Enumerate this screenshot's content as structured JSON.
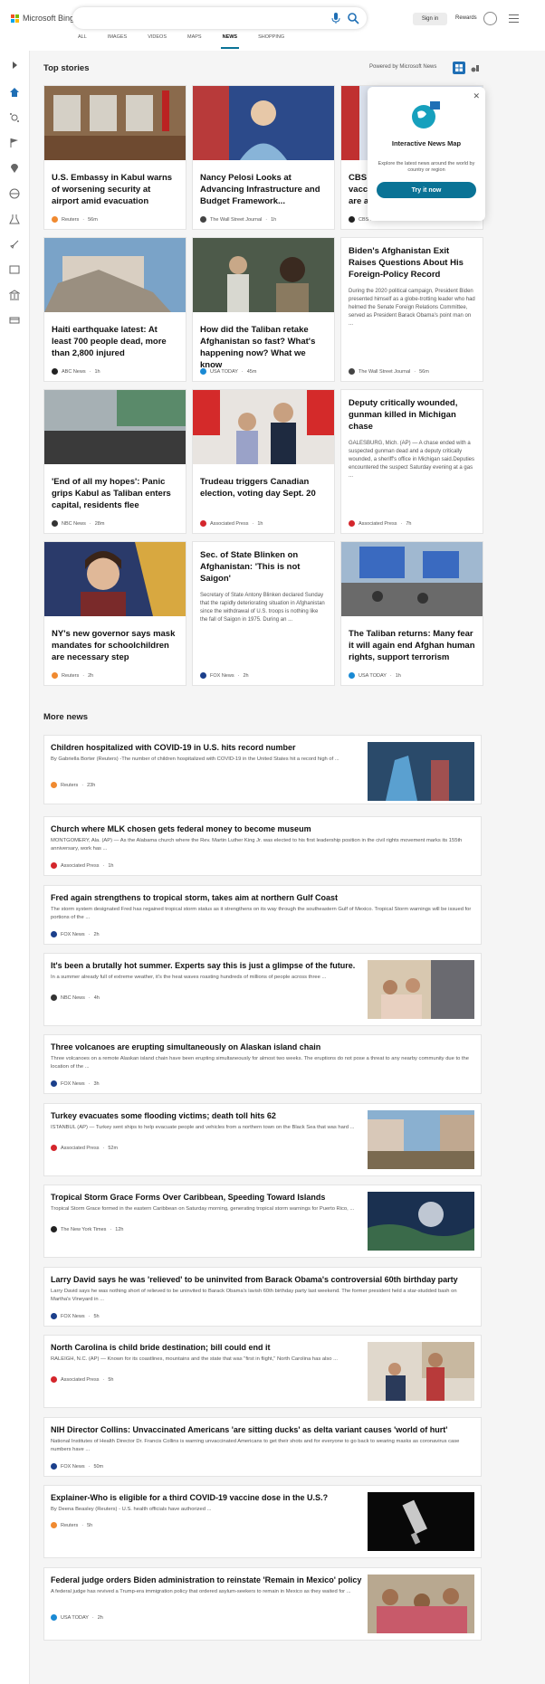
{
  "header": {
    "logo_text": "Microsoft Bing",
    "search_value": "",
    "signin": "Sign in",
    "rewards": "Rewards",
    "tabs": [
      "ALL",
      "IMAGES",
      "VIDEOS",
      "MAPS",
      "NEWS",
      "SHOPPING"
    ],
    "active_tab": "NEWS"
  },
  "top_stories": {
    "title": "Top stories",
    "powered_by": "Powered by Microsoft News",
    "cards": [
      {
        "title": "U.S. Embassy in Kabul warns of worsening security at airport amid evacuation",
        "source": "Reuters",
        "time": "56m",
        "src_color": "#f08a30"
      },
      {
        "title": "Nancy Pelosi Looks at Advancing Infrastructure and Budget Framework...",
        "source": "The Wall Street Journal",
        "time": "1h",
        "src_color": "#444444"
      },
      {
        "title": "CBS vacc are a",
        "source": "CBS News",
        "time": "2h",
        "src_color": "#222222"
      },
      {
        "title": "Haiti earthquake latest: At least 700 people dead, more than 2,800 injured",
        "source": "ABC News",
        "time": "1h",
        "src_color": "#222222"
      },
      {
        "title": "How did the Taliban retake Afghanistan so fast? What's happening now? What we know",
        "source": "USA TODAY",
        "time": "45m",
        "src_color": "#1a8ad4"
      },
      {
        "title": "Biden's Afghanistan Exit Raises Questions About His Foreign-Policy Record",
        "snippet": "During the 2020 political campaign, President Biden presented himself as a globe-trotting leader who had helmed the Senate Foreign Relations Committee, served as President Barack Obama's point man on ...",
        "source": "The Wall Street Journal",
        "time": "56m",
        "src_color": "#444444"
      },
      {
        "title": "'End of all my hopes': Panic grips Kabul as Taliban enters capital, residents flee",
        "source": "NBC News",
        "time": "28m",
        "src_color": "#333333"
      },
      {
        "title": "Trudeau triggers Canadian election, voting day Sept. 20",
        "source": "Associated Press",
        "time": "1h",
        "src_color": "#d4262c"
      },
      {
        "title": "Deputy critically wounded, gunman killed in Michigan chase",
        "snippet": "GALESBURG, Mich. (AP) — A chase ended with a suspected gunman dead and a deputy critically wounded, a sheriff's office in Michigan said.Deputies encountered the suspect Saturday evening at a gas ...",
        "source": "Associated Press",
        "time": "7h",
        "src_color": "#d4262c"
      },
      {
        "title": "NY's new governor says mask mandates for schoolchildren are necessary step",
        "source": "Reuters",
        "time": "2h",
        "src_color": "#f08a30"
      },
      {
        "title": "Sec. of State Blinken on Afghanistan: 'This is not Saigon'",
        "snippet": "Secretary of State Antony Blinken declared Sunday that the rapidly deteriorating situation in Afghanistan since the withdrawal of U.S. troops is nothing like the fall of Saigon in 1975. During an ...",
        "source": "FOX News",
        "time": "2h",
        "src_color": "#1b3f8b"
      },
      {
        "title": "The Taliban returns: Many fear it will again end Afghan human rights, support terrorism",
        "source": "USA TODAY",
        "time": "1h",
        "src_color": "#1a8ad4"
      }
    ],
    "map_popup": {
      "title": "Interactive News Map",
      "description": "Explore the latest news around the world by country or region",
      "button": "Try it now"
    }
  },
  "more_news": {
    "title": "More news",
    "items": [
      {
        "title": "Children hospitalized with COVID-19 in U.S. hits record number",
        "snippet": "By Gabriella Borter (Reuters) -The number of children hospitalized with COVID-19 in the United States hit a record high of ...",
        "source": "Reuters",
        "time": "23h",
        "src_color": "#f08a30"
      },
      {
        "title": "Church where MLK chosen gets federal money to become museum",
        "snippet": "MONTGOMERY, Ala. (AP) — As the Alabama church where the Rev. Martin Luther King Jr. was elected to his first leadership position in the civil rights movement marks its 155th anniversary, work has ...",
        "source": "Associated Press",
        "time": "1h",
        "src_color": "#d4262c"
      },
      {
        "title": "Fred again strengthens to tropical storm, takes aim at northern Gulf Coast",
        "snippet": "The storm system designated Fred has regained tropical storm status as it strengthens on its way through the southeastern Gulf of Mexico.  Tropical Storm warnings will be issued for portions of the ...",
        "source": "FOX News",
        "time": "2h",
        "src_color": "#1b3f8b"
      },
      {
        "title": "It's been a brutally hot summer. Experts say this is just a glimpse of the future.",
        "snippet": "In a summer already full of extreme weather, it's the heat waves roasting hundreds of millions of people across three ...",
        "source": "NBC News",
        "time": "4h",
        "src_color": "#333333"
      },
      {
        "title": "Three volcanoes are erupting simultaneously on Alaskan island chain",
        "snippet": "Three volcanoes on a remote Alaskan island chain have been erupting simultaneously for almost two weeks.  The eruptions do not pose a threat to any nearby community due to the location of the ...",
        "source": "FOX News",
        "time": "3h",
        "src_color": "#1b3f8b"
      },
      {
        "title": "Turkey evacuates some flooding victims; death toll hits 62",
        "snippet": "ISTANBUL (AP) — Turkey sent ships to help evacuate people and vehicles from a northern town on the Black Sea that was hard ...",
        "source": "Associated Press",
        "time": "52m",
        "src_color": "#d4262c"
      },
      {
        "title": "Tropical Storm Grace Forms Over Caribbean, Speeding Toward Islands",
        "snippet": "Tropical Storm Grace formed in the eastern Caribbean on Saturday morning, generating tropical storm warnings for Puerto Rico, ...",
        "source": "The New York Times",
        "time": "12h",
        "src_color": "#222222"
      },
      {
        "title": "Larry David says he was 'relieved' to be uninvited from Barack Obama's controversial 60th birthday party",
        "snippet": "Larry David says he was nothing short of relieved to be uninvited to Barack Obama's lavish 60th birthday party last weekend.  The former president held a star-studded bash on Martha's Vineyard in ...",
        "source": "FOX News",
        "time": "5h",
        "src_color": "#1b3f8b"
      },
      {
        "title": "North Carolina is child bride destination; bill could end it",
        "snippet": "RALEIGH, N.C. (AP) — Known for its coastlines, mountains and the state that was \"first in flight,\" North Carolina has also ...",
        "source": "Associated Press",
        "time": "5h",
        "src_color": "#d4262c"
      },
      {
        "title": "NIH Director Collins: Unvaccinated Americans 'are sitting ducks' as delta variant causes 'world of hurt'",
        "snippet": "National Institutes of Health Director Dr. Francis Collins is warning unvaccinated Americans to get their shots and for everyone to go back to wearing masks as coronavirus case numbers have ...",
        "source": "FOX News",
        "time": "50m",
        "src_color": "#1b3f8b"
      },
      {
        "title": "Explainer-Who is eligible for a third COVID-19 vaccine dose in the U.S.?",
        "snippet": "By Deena Beasley (Reuters) - U.S. health officials have authorized ...",
        "source": "Reuters",
        "time": "5h",
        "src_color": "#f08a30"
      },
      {
        "title": "Federal judge orders Biden administration to reinstate 'Remain in Mexico' policy",
        "snippet": "A federal judge has revived a Trump-era immigration policy that ordered asylum-seekers to remain in Mexico as they waited for ...",
        "source": "USA TODAY",
        "time": "2h",
        "src_color": "#1a8ad4"
      }
    ]
  },
  "colors": {
    "accent": "#0a7396",
    "brand_blue": "#1f6fb5"
  }
}
